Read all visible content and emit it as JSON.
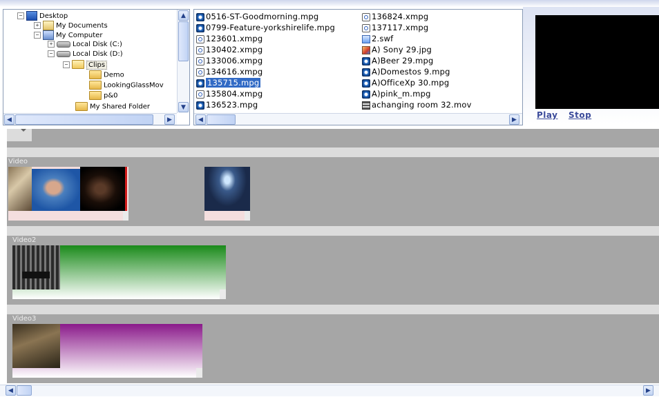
{
  "tree": {
    "nodes": [
      {
        "label": "Desktop",
        "expander": "−",
        "icon": "desktop-icon"
      },
      {
        "label": "My Documents",
        "expander": "+",
        "icon": "documents-folder-icon"
      },
      {
        "label": "My Computer",
        "expander": "−",
        "icon": "computer-icon"
      },
      {
        "label": "Local Disk (C:)",
        "expander": "+",
        "icon": "drive-icon"
      },
      {
        "label": "Local Disk (D:)",
        "expander": "−",
        "icon": "drive-icon"
      },
      {
        "label": "Clips",
        "expander": "−",
        "icon": "open-folder-icon"
      },
      {
        "label": "Demo",
        "expander": "",
        "icon": "folder-icon"
      },
      {
        "label": "LookingGlassMov",
        "expander": "",
        "icon": "folder-icon"
      },
      {
        "label": "p&0",
        "expander": "",
        "icon": "folder-icon"
      },
      {
        "label": "My Shared Folder",
        "expander": "",
        "icon": "folder-icon"
      }
    ]
  },
  "files": {
    "col1": [
      {
        "name": "0516-ST-Goodmorning.mpg",
        "type": "mpg"
      },
      {
        "name": "0799-Feature-yorkshirelife.mpg",
        "type": "mpg"
      },
      {
        "name": "123601.xmpg",
        "type": "xmpg"
      },
      {
        "name": "130402.xmpg",
        "type": "xmpg"
      },
      {
        "name": "133006.xmpg",
        "type": "xmpg"
      },
      {
        "name": "134616.xmpg",
        "type": "xmpg"
      },
      {
        "name": "135715.mpg",
        "type": "mpg",
        "selected": true
      },
      {
        "name": "135804.xmpg",
        "type": "xmpg"
      },
      {
        "name": "136523.mpg",
        "type": "mpg"
      }
    ],
    "col2": [
      {
        "name": "136824.xmpg",
        "type": "xmpg"
      },
      {
        "name": "137117.xmpg",
        "type": "xmpg"
      },
      {
        "name": "2.swf",
        "type": "swf"
      },
      {
        "name": "A) Sony 29.jpg",
        "type": "jpg"
      },
      {
        "name": "A)Beer 29.mpg",
        "type": "mpg"
      },
      {
        "name": "A)Domestos 9.mpg",
        "type": "mpg"
      },
      {
        "name": "A)OfficeXp 30.mpg",
        "type": "mpg"
      },
      {
        "name": "A)pink_m.mpg",
        "type": "mpg"
      },
      {
        "name": "achanging room 32.mov",
        "type": "mov"
      }
    ]
  },
  "player": {
    "play_label": "Play",
    "stop_label": "Stop"
  },
  "timeline": {
    "tracks": [
      {
        "label": "Video"
      },
      {
        "label": "Video2"
      },
      {
        "label": "Video3"
      }
    ]
  },
  "colors": {
    "track_bg": "#a6a6a6",
    "video2_gradient_start": "#1a8a1a",
    "video3_gradient_start": "#8a1a8a",
    "selection": "#316ac5"
  }
}
